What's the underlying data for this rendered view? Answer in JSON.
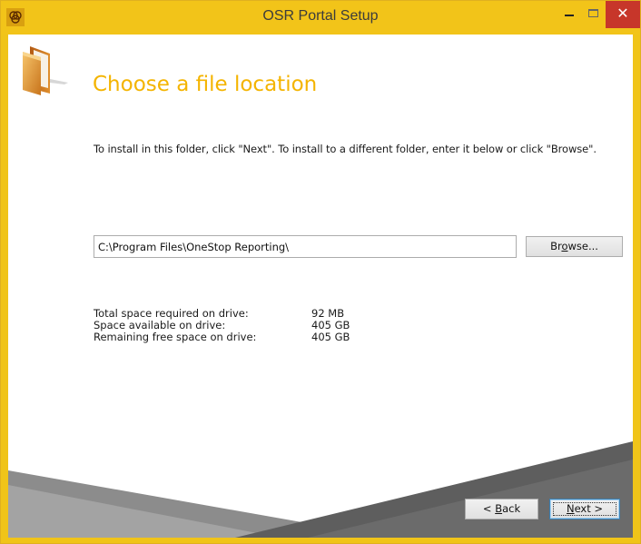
{
  "window": {
    "title": "OSR Portal Setup",
    "accent_color": "#f2c419",
    "close_color": "#c7362a"
  },
  "controls": {
    "app_icon": "osr-logo-icon",
    "minimize_icon": "minimize-icon",
    "maximize_icon": "maximize-icon",
    "close_icon": "close-icon",
    "close_glyph": "✕"
  },
  "page": {
    "icon": "folder-icon",
    "heading": "Choose a file location",
    "heading_color": "#f4b400",
    "instruction": "To install in this folder, click \"Next\". To install to a different folder, enter it below or click \"Browse\"."
  },
  "location": {
    "path_value": "C:\\Program Files\\OneStop Reporting\\",
    "browse": {
      "pre": "Br",
      "key": "o",
      "post": "wse..."
    }
  },
  "space": [
    {
      "label": "Total space required on drive:",
      "value": "92 MB"
    },
    {
      "label": "Space available on drive:",
      "value": "405 GB"
    },
    {
      "label": "Remaining free space on drive:",
      "value": "405 GB"
    }
  ],
  "nav": {
    "back": {
      "pre": "< ",
      "key": "B",
      "post": "ack"
    },
    "next": {
      "pre": "",
      "key": "N",
      "post": "ext >"
    }
  }
}
